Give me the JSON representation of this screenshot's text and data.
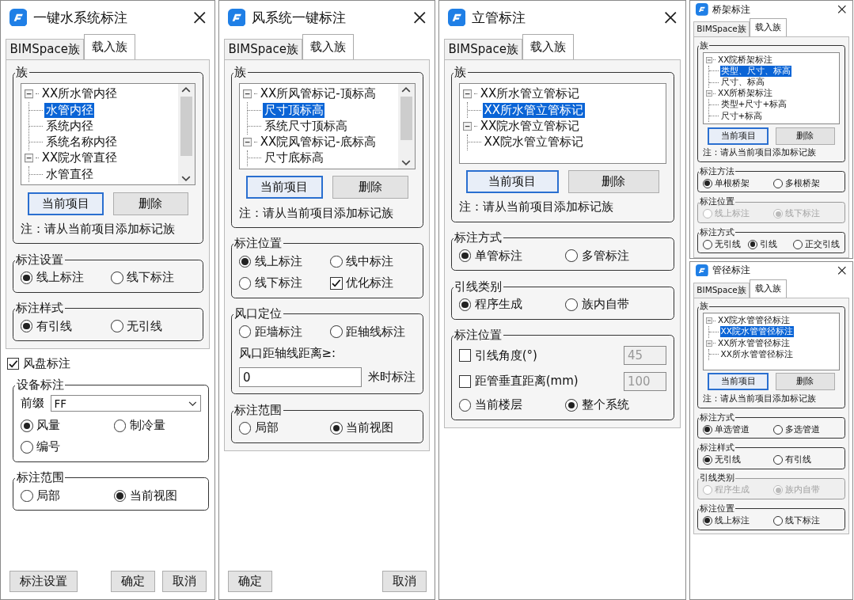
{
  "dialogs": [
    {
      "title": "一键水系统标注",
      "tabs": [
        {
          "label": "BIMSpace族",
          "selected": false
        },
        {
          "label": "载入族",
          "selected": true
        }
      ],
      "panel": [
        {
          "kind": "family",
          "title": "族",
          "scroll": true,
          "tree": [
            {
              "label": "XX所水管内径",
              "expanded": true,
              "selected": false,
              "children": [
                {
                  "label": "水管内径",
                  "selected": true
                },
                {
                  "label": "系统内径",
                  "selected": false
                },
                {
                  "label": "系统名称内径",
                  "selected": false
                }
              ]
            },
            {
              "label": "XX院水管直径",
              "expanded": true,
              "selected": false,
              "children": [
                {
                  "label": "水管直径",
                  "selected": false
                }
              ]
            }
          ],
          "buttons": [
            {
              "label": "当前项目",
              "default": true
            },
            {
              "label": "删除",
              "default": false
            }
          ],
          "note": "注：请从当前项目添加标记族"
        },
        {
          "kind": "options",
          "title": "标注设置",
          "disabled": false,
          "rows": [
            [
              {
                "kind": "radio",
                "label": "线上标注",
                "selected": true
              },
              {
                "kind": "radio",
                "label": "线下标注",
                "selected": false
              }
            ]
          ]
        },
        {
          "kind": "options",
          "title": "标注样式",
          "disabled": false,
          "rows": [
            [
              {
                "kind": "radio",
                "label": "有引线",
                "selected": true
              },
              {
                "kind": "radio",
                "label": "无引线",
                "selected": false
              }
            ]
          ]
        }
      ],
      "below": [
        {
          "kind": "checkgroup",
          "label": "风盘标注",
          "checked": true,
          "groups": [
            {
              "kind": "options",
              "title": "设备标注",
              "disabled": false,
              "rows": [
                [
                  {
                    "kind": "text",
                    "text": "前缀"
                  },
                  {
                    "kind": "combo",
                    "value": "FF"
                  }
                ],
                [
                  {
                    "kind": "radio",
                    "label": "风量",
                    "selected": true
                  },
                  {
                    "kind": "radio",
                    "label": "制冷量",
                    "selected": false
                  }
                ],
                [
                  {
                    "kind": "radio",
                    "label": "编号",
                    "selected": false
                  }
                ]
              ]
            },
            {
              "kind": "options",
              "title": "标注范围",
              "disabled": false,
              "rows": [
                [
                  {
                    "kind": "radio",
                    "label": "局部",
                    "selected": false
                  },
                  {
                    "kind": "radio",
                    "label": "当前视图",
                    "selected": true
                  }
                ]
              ]
            }
          ]
        }
      ],
      "buttons": [
        {
          "label": "标注设置",
          "default": false
        },
        {
          "label": "确定",
          "default": false
        },
        {
          "label": "取消",
          "default": false
        }
      ]
    },
    {
      "title": "风系统一键标注",
      "tabs": [
        {
          "label": "BIMSpace族",
          "selected": false
        },
        {
          "label": "载入族",
          "selected": true
        }
      ],
      "panel": [
        {
          "kind": "family",
          "title": "族",
          "scroll": true,
          "tree": [
            {
              "label": "XX所风管标记-顶标高",
              "expanded": true,
              "selected": false,
              "children": [
                {
                  "label": "尺寸顶标高",
                  "selected": true
                },
                {
                  "label": "系统尺寸顶标高",
                  "selected": false
                }
              ]
            },
            {
              "label": "XX院风管标记-底标高",
              "expanded": true,
              "selected": false,
              "children": [
                {
                  "label": "尺寸底标高",
                  "selected": false
                }
              ]
            }
          ],
          "buttons": [
            {
              "label": "当前项目",
              "default": true
            },
            {
              "label": "删除",
              "default": false
            }
          ],
          "note": "注：请从当前项目添加标记族"
        },
        {
          "kind": "options",
          "title": "标注位置",
          "disabled": false,
          "rows": [
            [
              {
                "kind": "radio",
                "label": "线上标注",
                "selected": true
              },
              {
                "kind": "radio",
                "label": "线中标注",
                "selected": false
              }
            ],
            [
              {
                "kind": "radio",
                "label": "线下标注",
                "selected": false
              },
              {
                "kind": "check",
                "label": "优化标注",
                "checked": true
              }
            ]
          ]
        },
        {
          "kind": "options",
          "title": "风口定位",
          "disabled": false,
          "rows": [
            [
              {
                "kind": "radio",
                "label": "距墙标注",
                "selected": false
              },
              {
                "kind": "radio",
                "label": "距轴线标注",
                "selected": false
              }
            ],
            [
              {
                "kind": "text",
                "text": "风口距轴线距离≥:"
              }
            ],
            [
              {
                "kind": "field",
                "value": "0",
                "disabled": false
              },
              {
                "kind": "text",
                "text": "米时标注"
              }
            ]
          ]
        },
        {
          "kind": "options",
          "title": "标注范围",
          "disabled": false,
          "rows": [
            [
              {
                "kind": "radio",
                "label": "局部",
                "selected": false
              },
              {
                "kind": "radio",
                "label": "当前视图",
                "selected": true
              }
            ]
          ]
        }
      ],
      "buttons": [
        {
          "label": "确定",
          "default": false
        },
        {
          "label": "取消",
          "default": false
        }
      ]
    },
    {
      "title": "立管标注",
      "tabs": [
        {
          "label": "BIMSpace族",
          "selected": false
        },
        {
          "label": "载入族",
          "selected": true
        }
      ],
      "panel": [
        {
          "kind": "family",
          "title": "族",
          "scroll": false,
          "tree": [
            {
              "label": "XX所水管立管标记",
              "expanded": true,
              "selected": false,
              "children": [
                {
                  "label": "XX所水管立管标记",
                  "selected": true
                }
              ]
            },
            {
              "label": "XX院水管立管标记",
              "expanded": true,
              "selected": false,
              "children": [
                {
                  "label": "XX院水管立管标记",
                  "selected": false
                }
              ]
            }
          ],
          "buttons": [
            {
              "label": "当前项目",
              "default": true
            },
            {
              "label": "删除",
              "default": false
            }
          ],
          "note": "注：请从当前项目添加标记族"
        },
        {
          "kind": "options",
          "title": "标注方式",
          "disabled": false,
          "rows": [
            [
              {
                "kind": "radio",
                "label": "单管标注",
                "selected": true
              },
              {
                "kind": "radio",
                "label": "多管标注",
                "selected": false
              }
            ]
          ]
        },
        {
          "kind": "options",
          "title": "引线类别",
          "disabled": false,
          "rows": [
            [
              {
                "kind": "radio",
                "label": "程序生成",
                "selected": true
              },
              {
                "kind": "radio",
                "label": "族内自带",
                "selected": false
              }
            ]
          ]
        },
        {
          "kind": "options",
          "title": "标注位置",
          "disabled": false,
          "rows": [
            [
              {
                "kind": "check",
                "label": "引线角度(°)",
                "checked": false
              },
              {
                "kind": "field",
                "value": "45",
                "disabled": true
              }
            ],
            [
              {
                "kind": "check",
                "label": "距管垂直距离(mm)",
                "checked": false
              },
              {
                "kind": "field",
                "value": "100",
                "disabled": true
              }
            ],
            [
              {
                "kind": "radio",
                "label": "当前楼层",
                "selected": false
              },
              {
                "kind": "radio",
                "label": "整个系统",
                "selected": true
              }
            ]
          ]
        }
      ]
    },
    {
      "title": "桥架标注",
      "tabs": [
        {
          "label": "BIMSpace族",
          "selected": false
        },
        {
          "label": "载入族",
          "selected": true
        }
      ],
      "panel": [
        {
          "kind": "family",
          "title": "族",
          "scroll": false,
          "tree": [
            {
              "label": "XX院桥架标注",
              "expanded": true,
              "selected": false,
              "children": [
                {
                  "label": "类型、尺寸、标高",
                  "selected": true
                },
                {
                  "label": "尺寸、标高",
                  "selected": false
                }
              ]
            },
            {
              "label": "XX所桥架标注",
              "expanded": true,
              "selected": false,
              "children": [
                {
                  "label": "类型+尺寸+标高",
                  "selected": false
                },
                {
                  "label": "尺寸+标高",
                  "selected": false
                }
              ]
            }
          ],
          "buttons": [
            {
              "label": "当前项目",
              "default": true
            },
            {
              "label": "删除",
              "default": false
            }
          ],
          "note": "注：请从当前项目添加标记族"
        },
        {
          "kind": "options",
          "title": "标注方法",
          "disabled": false,
          "rows": [
            [
              {
                "kind": "radio",
                "label": "单根桥架",
                "selected": true
              },
              {
                "kind": "radio",
                "label": "多根桥架",
                "selected": false
              }
            ]
          ]
        },
        {
          "kind": "options",
          "title": "标注位置",
          "disabled": true,
          "rows": [
            [
              {
                "kind": "radio",
                "label": "线上标注",
                "selected": false
              },
              {
                "kind": "radio",
                "label": "线下标注",
                "selected": true
              }
            ]
          ]
        },
        {
          "kind": "options",
          "title": "标注方式",
          "disabled": false,
          "rows": [
            [
              {
                "kind": "radio",
                "label": "无引线",
                "selected": false
              },
              {
                "kind": "radio",
                "label": "引线",
                "selected": true
              },
              {
                "kind": "radio",
                "label": "正交引线",
                "selected": false
              }
            ]
          ]
        }
      ]
    },
    {
      "title": "管径标注",
      "tabs": [
        {
          "label": "BIMSpace族",
          "selected": false
        },
        {
          "label": "载入族",
          "selected": true
        }
      ],
      "panel": [
        {
          "kind": "family",
          "title": "族",
          "scroll": false,
          "tree": [
            {
              "label": "XX院水管管径标注",
              "expanded": true,
              "selected": false,
              "children": [
                {
                  "label": "XX院水管管径标注",
                  "selected": true
                }
              ]
            },
            {
              "label": "XX所水管管径标注",
              "expanded": true,
              "selected": false,
              "children": [
                {
                  "label": "XX所水管管径标注",
                  "selected": false
                }
              ]
            }
          ],
          "buttons": [
            {
              "label": "当前项目",
              "default": true
            },
            {
              "label": "删除",
              "default": false
            }
          ],
          "note": "注：请从当前项目添加标记族"
        },
        {
          "kind": "options",
          "title": "标注方式",
          "disabled": false,
          "rows": [
            [
              {
                "kind": "radio",
                "label": "单选管道",
                "selected": true
              },
              {
                "kind": "radio",
                "label": "多选管道",
                "selected": false
              }
            ]
          ]
        },
        {
          "kind": "options",
          "title": "标注样式",
          "disabled": false,
          "rows": [
            [
              {
                "kind": "radio",
                "label": "无引线",
                "selected": true
              },
              {
                "kind": "radio",
                "label": "有引线",
                "selected": false
              }
            ]
          ]
        },
        {
          "kind": "options",
          "title": "引线类别",
          "disabled": true,
          "rows": [
            [
              {
                "kind": "radio",
                "label": "程序生成",
                "selected": false
              },
              {
                "kind": "radio",
                "label": "族内自带",
                "selected": true
              }
            ]
          ]
        },
        {
          "kind": "options",
          "title": "标注位置",
          "disabled": false,
          "rows": [
            [
              {
                "kind": "radio",
                "label": "线上标注",
                "selected": true
              },
              {
                "kind": "radio",
                "label": "线下标注",
                "selected": false
              }
            ]
          ]
        }
      ]
    }
  ]
}
